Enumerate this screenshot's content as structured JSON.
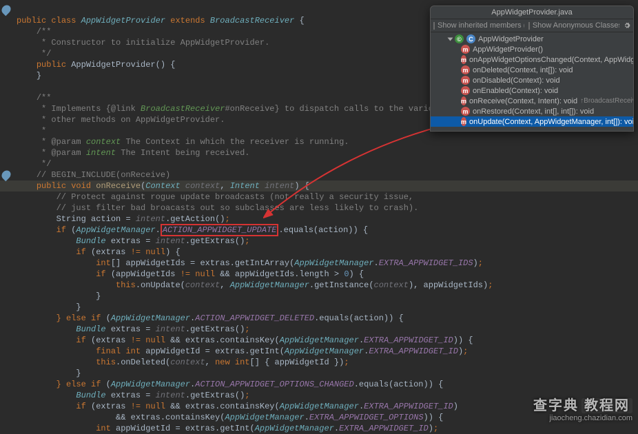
{
  "code": {
    "class_decl_public": "public",
    "class_decl_class": "class",
    "class_name": "AppWidgetProvider",
    "extends_kw": "extends",
    "super_class": "BroadcastReceiver",
    "brace_open": " {",
    "doc_open": "/**",
    "doc_ctor": " * Constructor to initialize AppWidgetProvider.",
    "doc_close": " */",
    "ctor_decl": "public",
    "ctor_name": "AppWidgetProvider",
    "ctor_sig": "() {",
    "ctor_close": "}",
    "doc2_l1": "/**",
    "doc2_l2": " * Implements {@link ",
    "doc2_link": "BroadcastReceiver",
    "doc2_l2b": "#onReceive} to dispatch calls to the various",
    "doc2_l3": " * other methods on AppWidgetProvider.",
    "doc2_star": " *",
    "doc2_p1a": " * @param ",
    "doc2_p1b": "context",
    "doc2_p1c": " The Context in which the receiver is running.",
    "doc2_p2a": " * @param ",
    "doc2_p2b": "intent",
    "doc2_p2c": " The Intent being received.",
    "doc2_close": " */",
    "begin_inc": "// BEGIN_INCLUDE(onReceive)",
    "onrecv_public": "public",
    "onrecv_void": "void",
    "onrecv_name": "onReceive",
    "onrecv_ctx_t": "Context",
    "onrecv_ctx_n": "context",
    "onrecv_int_t": "Intent",
    "onrecv_int_n": "intent",
    "onrecv_c1": "// Protect against rogue update broadcasts (not really a security issue,",
    "onrecv_c2": "// just filter bad broacasts out so subclasses are less likely to crash).",
    "string_t": "String",
    "action_var": " action = ",
    "intent_ref": "intent",
    "getAction": ".getAction()",
    "if_kw": "if",
    "awm": "AppWidgetManager",
    "const_update": "ACTION_APPWIDGET_UPDATE",
    "equals_action": ".equals(action)) {",
    "bundle_t": "Bundle",
    "extras_decl": " extras = ",
    "getExtras": ".getExtras()",
    "if_extras_nn": " (extras ",
    "neq_null": "!= null",
    "int_arr": "int",
    "brackets": "[]",
    "awids": " appWidgetIds = extras.",
    "getIntArray": "getIntArray",
    "extra_ids": "EXTRA_APPWIDGET_IDS",
    "if_awids": " (appWidgetIds ",
    "and": " && ",
    "len_gt0": "appWidgetIds.length > ",
    "zero": "0",
    "this_kw": "this",
    "onUpdate_call": ".onUpdate(",
    "comma_sp": ", ",
    "getInstance": ".getInstance(",
    "close_paren_awids": ", appWidgetIds)",
    "else_if": "} else if",
    "const_deleted": "ACTION_APPWIDGET_DELETED",
    "containsKey": "containsKey",
    "extra_id": "EXTRA_APPWIDGET_ID",
    "final_kw": "final",
    "int_kw": "int",
    "awid_decl": " appWidgetId = extras.",
    "getInt": "getInt",
    "onDeleted_call": ".onDeleted(",
    "new_kw": "new",
    "int_arr_lit": "[] { appWidgetId })",
    "const_options": "ACTION_APPWIDGET_OPTIONS_CHANGED",
    "extra_options": "EXTRA_APPWIDGET_OPTIONS",
    "semicolon": ";",
    "close_brace": "}"
  },
  "panel": {
    "title": "AppWidgetProvider.java",
    "show_inherited": "Show inherited members (C...",
    "show_anon": "Show Anonymous Classes (...",
    "root": "AppWidgetProvider",
    "items": [
      {
        "label": "AppWidgetProvider()"
      },
      {
        "label": "onAppWidgetOptionsChanged(Context, AppWidgetM"
      },
      {
        "label": "onDeleted(Context, int[]): void"
      },
      {
        "label": "onDisabled(Context): void"
      },
      {
        "label": "onEnabled(Context): void"
      },
      {
        "label": "onReceive(Context, Intent): void",
        "override": "↑BroadcastReceiver"
      },
      {
        "label": "onRestored(Context, int[], int[]): void"
      },
      {
        "label": "onUpdate(Context, AppWidgetManager, int[]): void",
        "selected": true
      }
    ]
  },
  "watermark": {
    "main": "查字典",
    "box": "教程网",
    "url": "jiaocheng.chazidian.com"
  }
}
